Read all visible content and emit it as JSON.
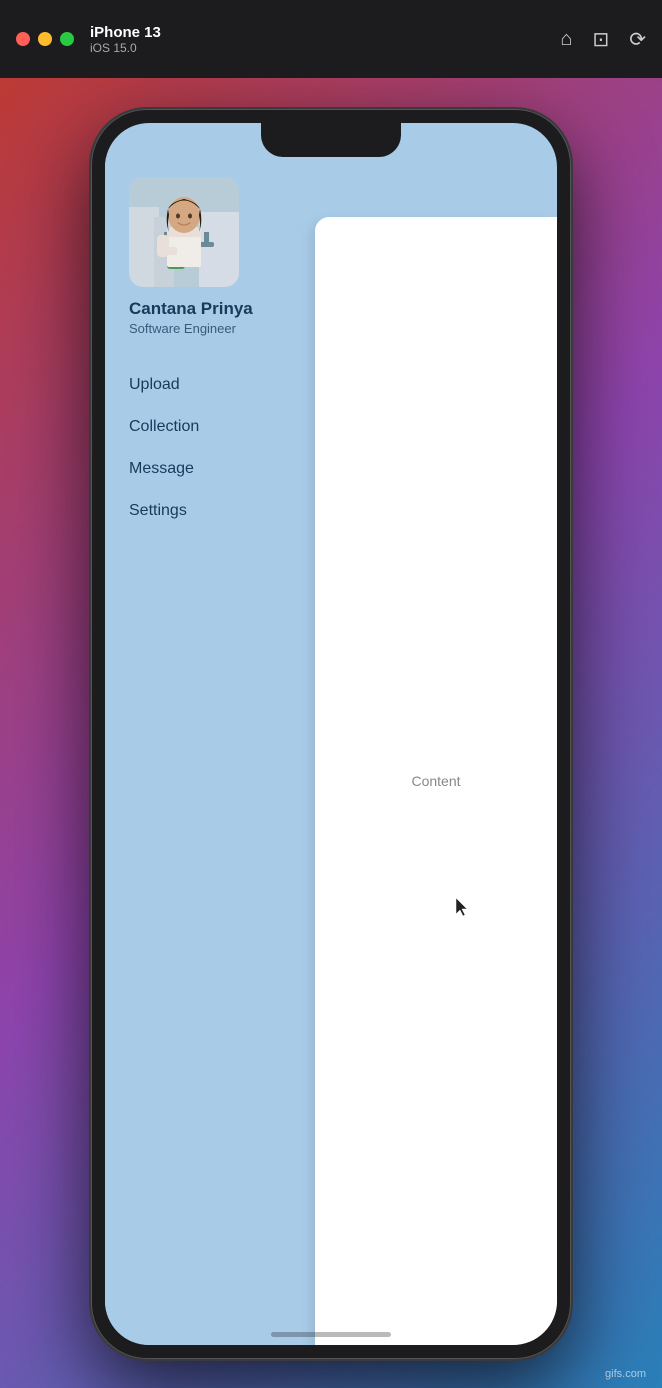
{
  "titlebar": {
    "device": "iPhone 13",
    "ios": "iOS 15.0",
    "traffic": {
      "close": "close",
      "minimize": "minimize",
      "maximize": "maximize"
    }
  },
  "profile": {
    "name": "Cantana Prinya",
    "title": "Software Engineer"
  },
  "nav": {
    "items": [
      {
        "label": "Upload",
        "id": "upload"
      },
      {
        "label": "Collection",
        "id": "collection"
      },
      {
        "label": "Message",
        "id": "message"
      },
      {
        "label": "Settings",
        "id": "settings"
      }
    ]
  },
  "content": {
    "label": "Content"
  },
  "watermark": "gifs.com"
}
